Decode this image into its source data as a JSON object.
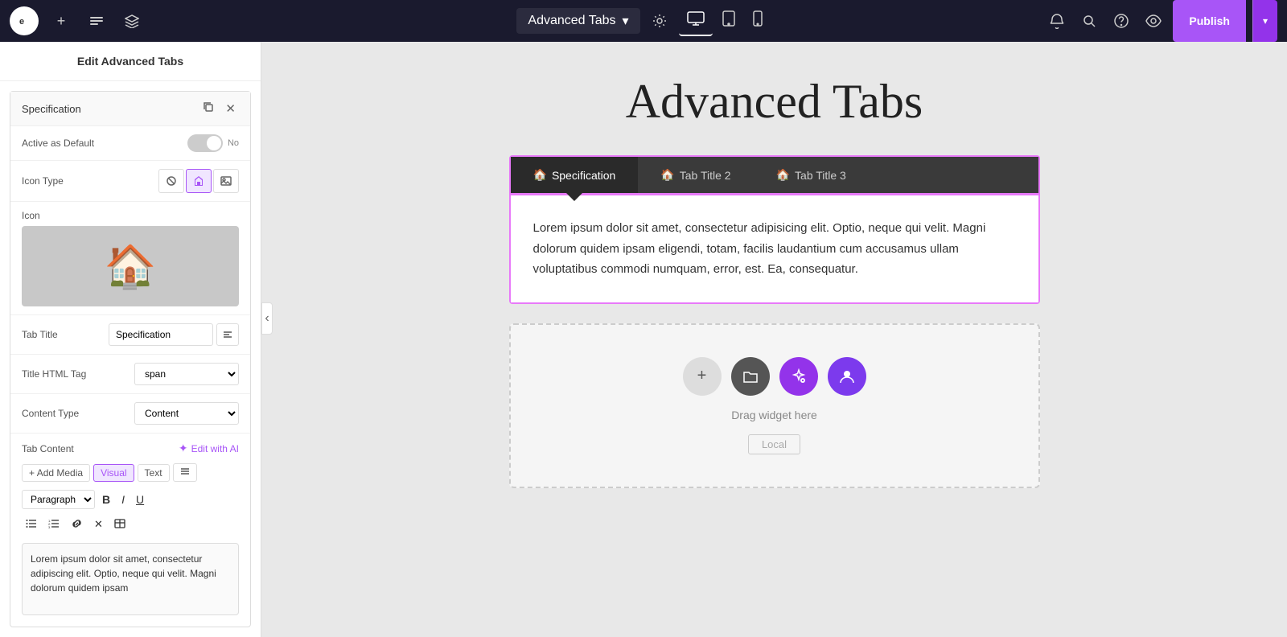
{
  "topnav": {
    "logo": "e",
    "add_label": "+",
    "page_title": "Advanced Tabs",
    "page_title_arrow": "▾",
    "device_desktop": "🖥",
    "device_tablet": "⬜",
    "device_mobile": "📱",
    "publish_label": "Publish",
    "publish_dropdown_arrow": "▾"
  },
  "left_panel": {
    "title": "Edit Advanced Tabs",
    "section_title": "Specification",
    "active_default_label": "Active as Default",
    "toggle_label": "No",
    "icon_type_label": "Icon Type",
    "icon_label": "Icon",
    "tab_title_label": "Tab Title",
    "tab_title_value": "Specification",
    "title_html_tag_label": "Title HTML Tag",
    "title_html_tag_value": "span",
    "content_type_label": "Content Type",
    "content_type_value": "Content",
    "tab_content_label": "Tab Content",
    "edit_with_ai": "Edit with AI",
    "add_media": "Add Media",
    "visual_btn": "Visual",
    "text_btn": "Text",
    "paragraph_select": "Paragraph",
    "content_body": "Lorem ipsum dolor sit amet, consectetur adipiscing elit. Optio, neque qui velit. Magni dolorum quidem ipsam"
  },
  "canvas": {
    "heading": "Advanced Tabs",
    "tabs": [
      {
        "label": "Specification",
        "active": true
      },
      {
        "label": "Tab Title 2",
        "active": false
      },
      {
        "label": "Tab Title 3",
        "active": false
      }
    ],
    "tab_content": "Lorem ipsum dolor sit amet, consectetur adipisicing elit. Optio, neque qui velit. Magni dolorum quidem ipsam eligendi, totam, facilis laudantium cum accusamus ullam voluptatibus commodi numquam, error, est. Ea, consequatur.",
    "drop_text": "Drag widget here",
    "drop_local": "Local"
  }
}
